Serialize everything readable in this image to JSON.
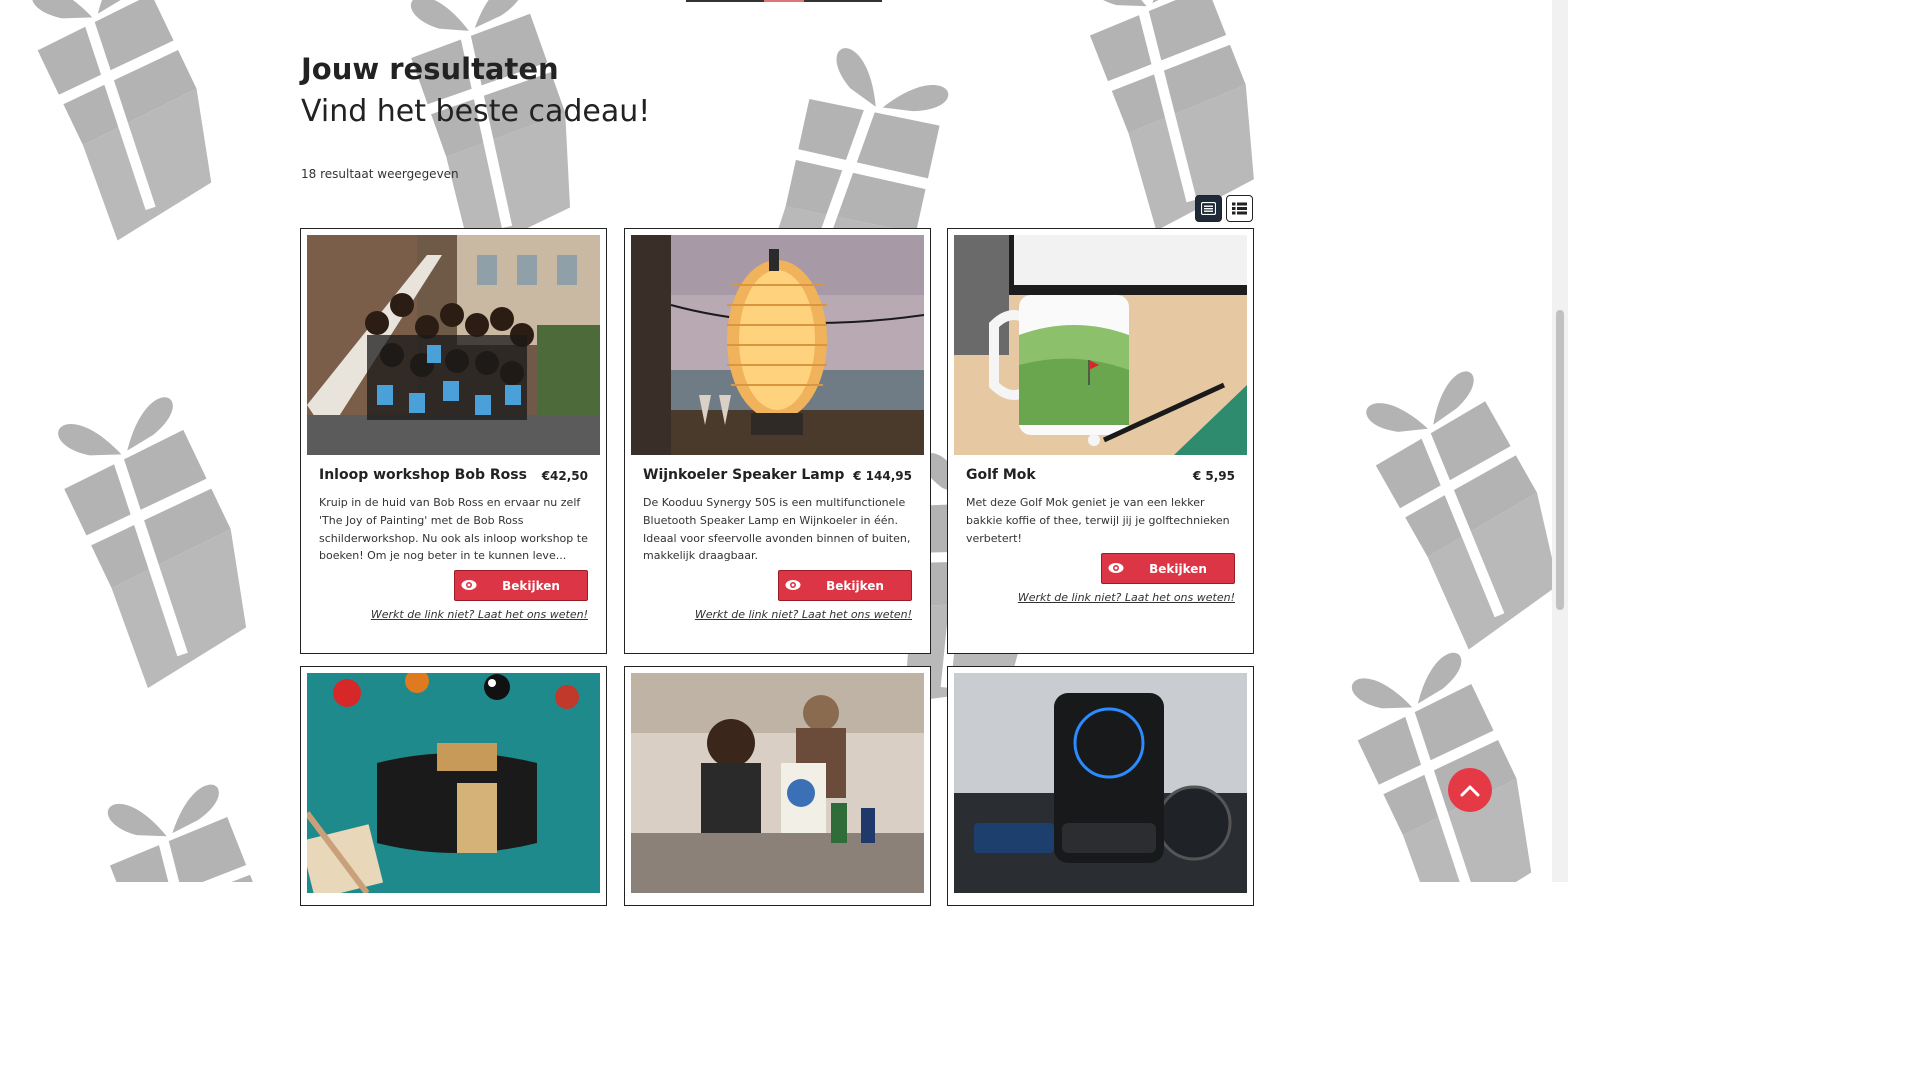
{
  "page": {
    "heading": "Jouw resultaten",
    "subheading": "Vind het beste cadeau!",
    "result_count": "18 resultaat weergegeven"
  },
  "view_toggle": {
    "options": [
      "grid-icon",
      "list-icon"
    ],
    "active": "grid-icon"
  },
  "products": [
    {
      "title": "Inloop workshop Bob Ross",
      "price": "€42,50",
      "description": "Kruip in de huid van Bob Ross en ervaar nu zelf 'The Joy of Painting' met de Bob Ross schilderworkshop. Nu ook als inloop workshop te boeken! Om je nog beter in te kunnen leve...",
      "button": "Bekijken",
      "report": "Werkt de link niet? Laat het ons weten!"
    },
    {
      "title": "Wijnkoeler Speaker Lamp",
      "price": "€ 144,95",
      "description": "De Kooduu Synergy 50S is een multifunctionele Bluetooth Speaker Lamp en Wijnkoeler in één. Ideaal voor sfeervolle avonden binnen of buiten, makkelijk draagbaar.",
      "button": "Bekijken",
      "report": "Werkt de link niet? Laat het ons weten!"
    },
    {
      "title": "Golf Mok",
      "price": "€ 5,95",
      "description": "Met deze Golf Mok geniet je van een lekker bakkie koffie of thee, terwijl jij je golftechnieken verbetert!",
      "button": "Bekijken",
      "report": "Werkt de link niet? Laat het ons weten!"
    }
  ],
  "product_images_row2": [
    "card-shuffler-photo",
    "painting-workshop-photo",
    "car-phone-holder-photo"
  ],
  "colors": {
    "accent": "#dc3545",
    "scroll_top": "#e63946",
    "gift_pattern": "#b3b3b3",
    "active_toggle": "#1f2a38"
  },
  "icons": {
    "button": "eye-icon",
    "scroll_top": "chevron-up-icon"
  }
}
